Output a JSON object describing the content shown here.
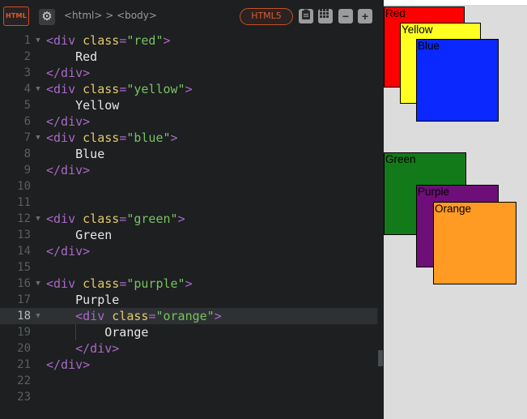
{
  "toolbar": {
    "badge": "HTML",
    "breadcrumb": "<html> > <body>",
    "mode": "HTML5",
    "icons": [
      "settings-gear-icon",
      "clipboard-icon",
      "grid-icon",
      "minus-icon",
      "plus-icon"
    ]
  },
  "code_lines": [
    {
      "n": "1",
      "fold": true,
      "html": "<span class=\"tag\">&lt;div </span><span class=\"attr\">class</span><span class=\"tag\">=</span><span class=\"str\">\"red\"</span><span class=\"tag\">&gt;</span>"
    },
    {
      "n": "2",
      "fold": false,
      "html": "    Red"
    },
    {
      "n": "3",
      "fold": false,
      "html": "<span class=\"tag\">&lt;/div&gt;</span>"
    },
    {
      "n": "4",
      "fold": true,
      "html": "<span class=\"tag\">&lt;div </span><span class=\"attr\">class</span><span class=\"tag\">=</span><span class=\"str\">\"yellow\"</span><span class=\"tag\">&gt;</span>"
    },
    {
      "n": "5",
      "fold": false,
      "html": "    Yellow"
    },
    {
      "n": "6",
      "fold": false,
      "html": "<span class=\"tag\">&lt;/div&gt;</span>"
    },
    {
      "n": "7",
      "fold": true,
      "html": "<span class=\"tag\">&lt;div </span><span class=\"attr\">class</span><span class=\"tag\">=</span><span class=\"str\">\"blue\"</span><span class=\"tag\">&gt;</span>"
    },
    {
      "n": "8",
      "fold": false,
      "html": "    Blue"
    },
    {
      "n": "9",
      "fold": false,
      "html": "<span class=\"tag\">&lt;/div&gt;</span>"
    },
    {
      "n": "10",
      "fold": false,
      "html": ""
    },
    {
      "n": "11",
      "fold": false,
      "html": ""
    },
    {
      "n": "12",
      "fold": true,
      "html": "<span class=\"tag\">&lt;div </span><span class=\"attr\">class</span><span class=\"tag\">=</span><span class=\"str\">\"green\"</span><span class=\"tag\">&gt;</span>"
    },
    {
      "n": "13",
      "fold": false,
      "html": "    Green"
    },
    {
      "n": "14",
      "fold": false,
      "html": "<span class=\"tag\">&lt;/div&gt;</span>"
    },
    {
      "n": "15",
      "fold": false,
      "html": ""
    },
    {
      "n": "16",
      "fold": true,
      "html": "<span class=\"tag\">&lt;div </span><span class=\"attr\">class</span><span class=\"tag\">=</span><span class=\"str\">\"purple\"</span><span class=\"tag\">&gt;</span>"
    },
    {
      "n": "17",
      "fold": false,
      "html": "    Purple"
    },
    {
      "n": "18",
      "fold": true,
      "active": true,
      "html": "    <span class=\"tag\">&lt;div </span><span class=\"attr\">class</span><span class=\"tag\">=</span><span class=\"str\">\"orange\"</span><span class=\"tag\">&gt;</span>"
    },
    {
      "n": "19",
      "fold": false,
      "guide": true,
      "html": "        Orange"
    },
    {
      "n": "20",
      "fold": false,
      "html": "    <span class=\"tag\">&lt;/div&gt;</span>"
    },
    {
      "n": "21",
      "fold": false,
      "html": "<span class=\"tag\">&lt;/div&gt;</span>"
    },
    {
      "n": "22",
      "fold": false,
      "html": ""
    },
    {
      "n": "23",
      "fold": false,
      "html": ""
    }
  ],
  "preview": {
    "boxes": [
      {
        "label": "Red",
        "color": "#ff0000"
      },
      {
        "label": "Yellow",
        "color": "#ffff22"
      },
      {
        "label": "Blue",
        "color": "#0a28ff"
      },
      {
        "label": "Green",
        "color": "#137a1a"
      },
      {
        "label": "Purple",
        "color": "#6e0e78"
      },
      {
        "label": "Orange",
        "color": "#ff9a22"
      }
    ]
  }
}
